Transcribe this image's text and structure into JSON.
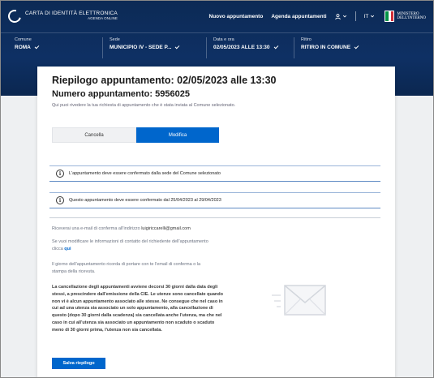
{
  "header": {
    "brand_title": "CARTA DI IDENTITÀ ELETTRONICA",
    "brand_sub": "AGENDA ONLINE",
    "nav": {
      "new_appointment": "Nuovo appuntamento",
      "agenda": "Agenda appuntamenti",
      "user_icon": "user-icon",
      "language": "IT"
    },
    "ministry_line1": "MINISTERO",
    "ministry_line2": "DELL'INTERNO",
    "flag_colors": [
      "#009246",
      "#ffffff",
      "#ce2b37"
    ]
  },
  "steps": [
    {
      "label": "Comune",
      "value": "ROMA"
    },
    {
      "label": "Sede",
      "value": "MUNICIPIO IV - SEDE P..."
    },
    {
      "label": "Data e ora",
      "value": "02/05/2023 ALLE 13:30"
    },
    {
      "label": "Ritiro",
      "value": "RITIRO IN COMUNE"
    }
  ],
  "summary": {
    "title": "Riepilogo appuntamento: 02/05/2023 alle 13:30",
    "number": "Numero appuntamento: 5956025",
    "description": "Qui puoi rivedere la tua richiesta di appuntamento che è stata inviata al Comune selezionato.",
    "tabs": {
      "cancel": "Cancella",
      "edit": "Modifica"
    },
    "notices": [
      "L'appuntamento deve essere confermato dalla sede del Comune selezionato",
      "Questo appuntamento deve essere confermato dal 25/04/2023 al 29/04/2023"
    ],
    "email_text": "Riceverai una e-mail di conferma all'indirizzo",
    "email": "luigiriccarelli@gmail.com",
    "contact_text_1": "Se vuoi modificare le informazioni di contatto del richiedente dell'appuntamento",
    "contact_text_2": "clicca",
    "contact_link": "qui",
    "reminder_1": "Il giorno dell'appuntamento ricorda di portare con te l'email di conferma o la",
    "reminder_2": "stampa della ricevuta.",
    "policy": [
      "La cancellazione degli appuntamenti avviene decorsi 30 giorni dalla data degli",
      "stessi, a prescindere dall'emissione della CIE. Le utenze sono cancellate quando",
      "non vi è alcun appuntamento associato alle stesse. Ne consegue che nel caso in",
      "cui ad una utenza sia associato un solo appuntamento, alla cancellazione di",
      "questo (dopo 30 giorni dalla scadenza) sia cancellata anche l'utenza, ma che nel",
      "caso in cui all'utenza sia associato un appuntamento non scaduto o scaduto",
      "meno di 30 giorni prima, l'utenza non sia cancellata."
    ],
    "save_button": "Salva riepilogo"
  },
  "colors": {
    "header_bg": "#0e3064",
    "primary": "#0066cc"
  }
}
